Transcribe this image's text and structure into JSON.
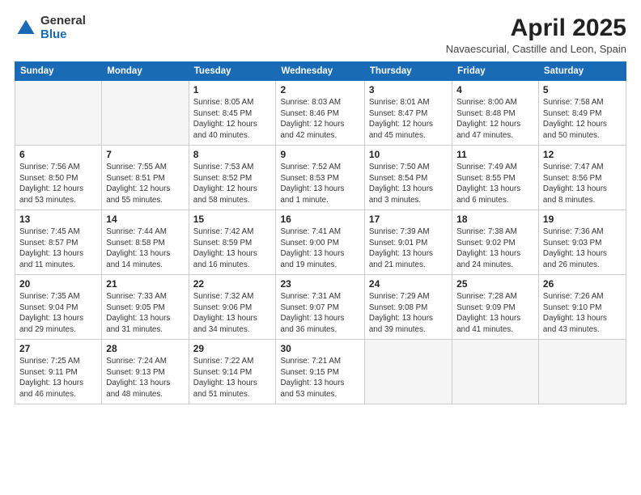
{
  "logo": {
    "general": "General",
    "blue": "Blue"
  },
  "title": {
    "month_year": "April 2025",
    "location": "Navaescurial, Castille and Leon, Spain"
  },
  "weekdays": [
    "Sunday",
    "Monday",
    "Tuesday",
    "Wednesday",
    "Thursday",
    "Friday",
    "Saturday"
  ],
  "weeks": [
    [
      {
        "day": "",
        "detail": ""
      },
      {
        "day": "",
        "detail": ""
      },
      {
        "day": "1",
        "detail": "Sunrise: 8:05 AM\nSunset: 8:45 PM\nDaylight: 12 hours\nand 40 minutes."
      },
      {
        "day": "2",
        "detail": "Sunrise: 8:03 AM\nSunset: 8:46 PM\nDaylight: 12 hours\nand 42 minutes."
      },
      {
        "day": "3",
        "detail": "Sunrise: 8:01 AM\nSunset: 8:47 PM\nDaylight: 12 hours\nand 45 minutes."
      },
      {
        "day": "4",
        "detail": "Sunrise: 8:00 AM\nSunset: 8:48 PM\nDaylight: 12 hours\nand 47 minutes."
      },
      {
        "day": "5",
        "detail": "Sunrise: 7:58 AM\nSunset: 8:49 PM\nDaylight: 12 hours\nand 50 minutes."
      }
    ],
    [
      {
        "day": "6",
        "detail": "Sunrise: 7:56 AM\nSunset: 8:50 PM\nDaylight: 12 hours\nand 53 minutes."
      },
      {
        "day": "7",
        "detail": "Sunrise: 7:55 AM\nSunset: 8:51 PM\nDaylight: 12 hours\nand 55 minutes."
      },
      {
        "day": "8",
        "detail": "Sunrise: 7:53 AM\nSunset: 8:52 PM\nDaylight: 12 hours\nand 58 minutes."
      },
      {
        "day": "9",
        "detail": "Sunrise: 7:52 AM\nSunset: 8:53 PM\nDaylight: 13 hours\nand 1 minute."
      },
      {
        "day": "10",
        "detail": "Sunrise: 7:50 AM\nSunset: 8:54 PM\nDaylight: 13 hours\nand 3 minutes."
      },
      {
        "day": "11",
        "detail": "Sunrise: 7:49 AM\nSunset: 8:55 PM\nDaylight: 13 hours\nand 6 minutes."
      },
      {
        "day": "12",
        "detail": "Sunrise: 7:47 AM\nSunset: 8:56 PM\nDaylight: 13 hours\nand 8 minutes."
      }
    ],
    [
      {
        "day": "13",
        "detail": "Sunrise: 7:45 AM\nSunset: 8:57 PM\nDaylight: 13 hours\nand 11 minutes."
      },
      {
        "day": "14",
        "detail": "Sunrise: 7:44 AM\nSunset: 8:58 PM\nDaylight: 13 hours\nand 14 minutes."
      },
      {
        "day": "15",
        "detail": "Sunrise: 7:42 AM\nSunset: 8:59 PM\nDaylight: 13 hours\nand 16 minutes."
      },
      {
        "day": "16",
        "detail": "Sunrise: 7:41 AM\nSunset: 9:00 PM\nDaylight: 13 hours\nand 19 minutes."
      },
      {
        "day": "17",
        "detail": "Sunrise: 7:39 AM\nSunset: 9:01 PM\nDaylight: 13 hours\nand 21 minutes."
      },
      {
        "day": "18",
        "detail": "Sunrise: 7:38 AM\nSunset: 9:02 PM\nDaylight: 13 hours\nand 24 minutes."
      },
      {
        "day": "19",
        "detail": "Sunrise: 7:36 AM\nSunset: 9:03 PM\nDaylight: 13 hours\nand 26 minutes."
      }
    ],
    [
      {
        "day": "20",
        "detail": "Sunrise: 7:35 AM\nSunset: 9:04 PM\nDaylight: 13 hours\nand 29 minutes."
      },
      {
        "day": "21",
        "detail": "Sunrise: 7:33 AM\nSunset: 9:05 PM\nDaylight: 13 hours\nand 31 minutes."
      },
      {
        "day": "22",
        "detail": "Sunrise: 7:32 AM\nSunset: 9:06 PM\nDaylight: 13 hours\nand 34 minutes."
      },
      {
        "day": "23",
        "detail": "Sunrise: 7:31 AM\nSunset: 9:07 PM\nDaylight: 13 hours\nand 36 minutes."
      },
      {
        "day": "24",
        "detail": "Sunrise: 7:29 AM\nSunset: 9:08 PM\nDaylight: 13 hours\nand 39 minutes."
      },
      {
        "day": "25",
        "detail": "Sunrise: 7:28 AM\nSunset: 9:09 PM\nDaylight: 13 hours\nand 41 minutes."
      },
      {
        "day": "26",
        "detail": "Sunrise: 7:26 AM\nSunset: 9:10 PM\nDaylight: 13 hours\nand 43 minutes."
      }
    ],
    [
      {
        "day": "27",
        "detail": "Sunrise: 7:25 AM\nSunset: 9:11 PM\nDaylight: 13 hours\nand 46 minutes."
      },
      {
        "day": "28",
        "detail": "Sunrise: 7:24 AM\nSunset: 9:13 PM\nDaylight: 13 hours\nand 48 minutes."
      },
      {
        "day": "29",
        "detail": "Sunrise: 7:22 AM\nSunset: 9:14 PM\nDaylight: 13 hours\nand 51 minutes."
      },
      {
        "day": "30",
        "detail": "Sunrise: 7:21 AM\nSunset: 9:15 PM\nDaylight: 13 hours\nand 53 minutes."
      },
      {
        "day": "",
        "detail": ""
      },
      {
        "day": "",
        "detail": ""
      },
      {
        "day": "",
        "detail": ""
      }
    ]
  ]
}
